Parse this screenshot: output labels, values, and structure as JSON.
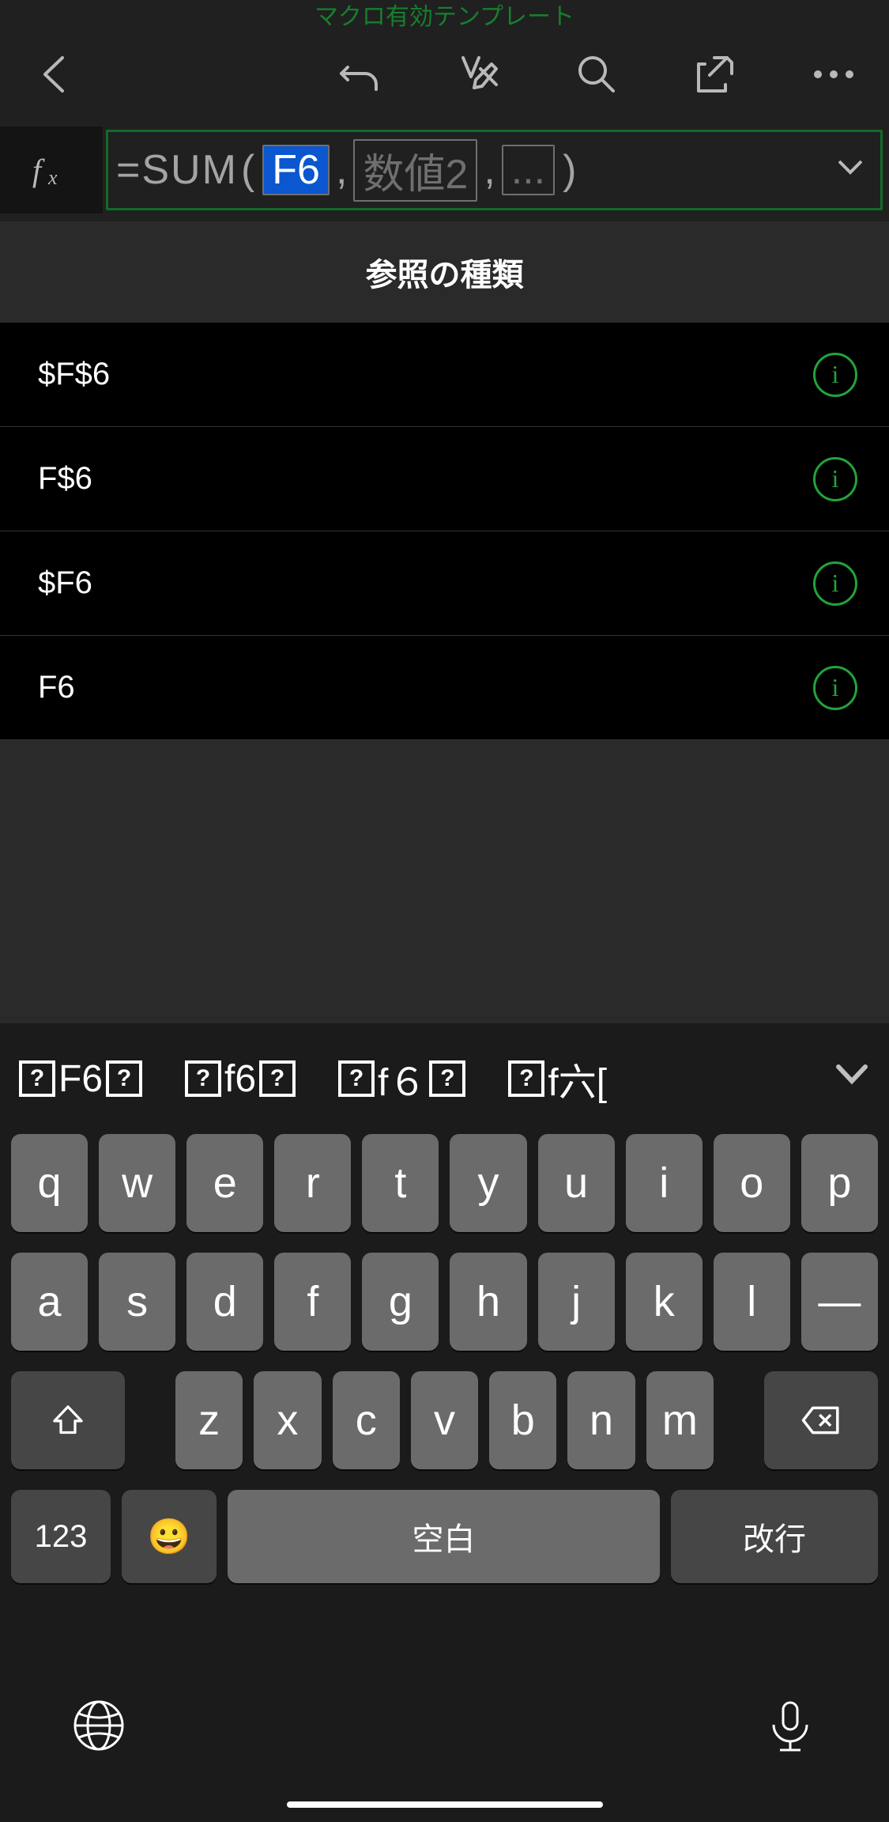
{
  "doc_title": "マクロ有効テンプレート",
  "formula": {
    "eq": "=",
    "fn": "SUM",
    "open": "(",
    "arg_selected": "F6",
    "comma1": ",",
    "arg2": "数値2",
    "comma2": ",",
    "arg3": "...",
    "close": ")"
  },
  "section_header": "参照の種類",
  "references": [
    {
      "label": "$F$6"
    },
    {
      "label": "F$6"
    },
    {
      "label": "$F6"
    },
    {
      "label": "F6"
    }
  ],
  "info_glyph": "i",
  "candidates": [
    {
      "pre": "?",
      "mid": "F6",
      "post": "?"
    },
    {
      "pre": "?",
      "mid": "f6",
      "post": "?"
    },
    {
      "pre": "?",
      "mid": "f６",
      "post": "?"
    },
    {
      "pre": "?",
      "mid": "f六[",
      "post": ""
    }
  ],
  "keyboard": {
    "row1": [
      "q",
      "w",
      "e",
      "r",
      "t",
      "y",
      "u",
      "i",
      "o",
      "p"
    ],
    "row2": [
      "a",
      "s",
      "d",
      "f",
      "g",
      "h",
      "j",
      "k",
      "l",
      "—"
    ],
    "row3": [
      "z",
      "x",
      "c",
      "v",
      "b",
      "n",
      "m"
    ],
    "num_label": "123",
    "space_label": "空白",
    "return_label": "改行"
  }
}
